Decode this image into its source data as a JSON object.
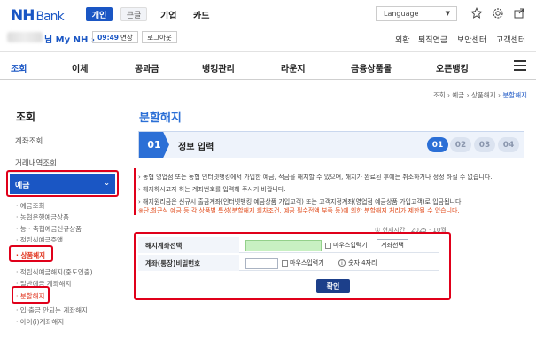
{
  "header": {
    "logo": "NH",
    "logo_sub": "Bank",
    "segments": [
      "개인",
      "큰글"
    ],
    "top_nav": [
      "기업",
      "카드"
    ],
    "language": "Language",
    "user_suffix": "님 My NH",
    "session_time": "09:49",
    "session_extend": "연장",
    "logout": "로그아웃",
    "util_nav": [
      "외환",
      "퇴직연금",
      "보안센터",
      "고객센터"
    ]
  },
  "gnb": [
    "조회",
    "이체",
    "공과금",
    "뱅킹관리",
    "라운지",
    "금융상품몰",
    "오픈뱅킹"
  ],
  "sidebar": {
    "title": "조회",
    "items": [
      "계좌조회",
      "거래내역조회"
    ],
    "active": "예금",
    "subs": [
      "· 예금조회",
      "· 농협은행예금상품",
      "· 농 · 축협예금신규상품",
      "· 적립식예금증액"
    ],
    "section": "· 상품해지",
    "section_items": [
      "· 적립식예금해지(중도인출)",
      "· 일반예금 계좌해지"
    ],
    "current": "· 분할해지",
    "tail": [
      "· 입·출금 안되는 계좌해지",
      "· 아이(i)계좌해지"
    ]
  },
  "main": {
    "breadcrumb": [
      "조회",
      "예금",
      "상품해지"
    ],
    "breadcrumb_current": "분할해지",
    "title": "분할해지",
    "step_num": "01",
    "step_label": "정보 입력",
    "steps": [
      "01",
      "02",
      "03",
      "04"
    ],
    "notices": [
      "농협 영업점 또는 농협 인터넷뱅킹에서 가입한 예금, 적금을 해지할 수 있으며, 해지가 완료된 후에는 취소하거나 정정 하실 수 없습니다.",
      "해지하시고자 하는 계좌번호를 입력해 주시기 바랍니다.",
      "해지원리금은 신규시 출금계좌(인터넷뱅킹 예금상품 가입고객) 또는 고객지정계좌(영업점 예금상품 가입고객)로 입금됩니다.",
      "※단,최근식 예금 등 각 상품별 특성(분할해지 회차조건, 예금 필수전액 부족 등)에 의한 분할해지 처리가 제한될 수 있습니다."
    ],
    "date_text": "① 현재시간 · 2025 · 10월",
    "form": {
      "row1_label": "해지계좌선택",
      "row2_label": "계좌(통장)비밀번호",
      "mouse_input": "마우스입력기",
      "account_select": "계좌선택",
      "pw_hint": "숫자 4자리",
      "confirm": "확인"
    }
  }
}
